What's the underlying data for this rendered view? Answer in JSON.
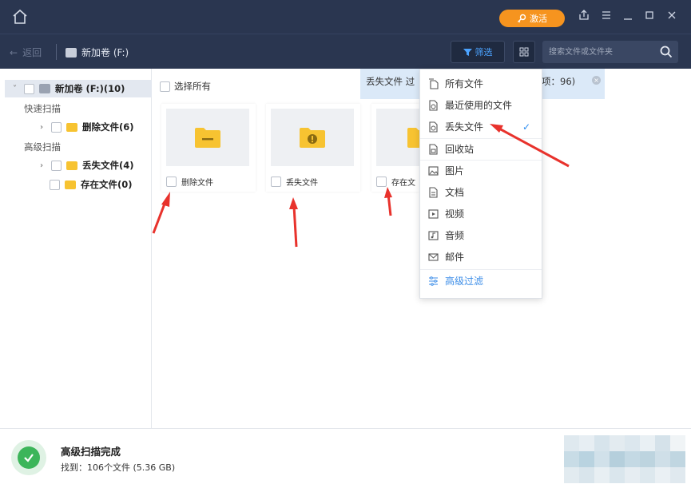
{
  "titlebar": {
    "activate_label": "激活",
    "icons": [
      "home-icon",
      "key-icon",
      "share-icon",
      "menu-icon",
      "minimize-icon",
      "maximize-icon",
      "close-icon"
    ]
  },
  "toolbar": {
    "back_label": "返回",
    "breadcrumb": "新加卷 (F:)",
    "filter_label": "筛选",
    "search_placeholder": "搜索文件或文件夹"
  },
  "sidebar": {
    "root_label": "新加卷 (F:)(10)",
    "quick_scan_label": "快速扫描",
    "deleted_files_label": "删除文件(6)",
    "advanced_scan_label": "高级扫描",
    "lost_files_label": "丢失文件(4)",
    "existing_files_label": "存在文件(0)"
  },
  "content": {
    "select_all_label": "选择所有",
    "info_text_left": "丢失文件 过",
    "info_text_right": "项：96)",
    "cards": [
      {
        "label": "删除文件"
      },
      {
        "label": "丢失文件"
      },
      {
        "label": "存在文"
      }
    ]
  },
  "dropdown": {
    "items": [
      {
        "label": "所有文件",
        "icon": "all-files-icon"
      },
      {
        "label": "最近使用的文件",
        "icon": "recent-files-icon"
      },
      {
        "label": "丢失文件",
        "icon": "lost-files-icon",
        "checked": true
      },
      {
        "label": "回收站",
        "icon": "recycle-bin-icon"
      },
      {
        "label": "图片",
        "icon": "image-icon"
      },
      {
        "label": "文档",
        "icon": "document-icon"
      },
      {
        "label": "视频",
        "icon": "video-icon"
      },
      {
        "label": "音频",
        "icon": "audio-icon"
      },
      {
        "label": "邮件",
        "icon": "mail-icon"
      },
      {
        "label": "高级过滤",
        "icon": "advanced-filter-icon"
      }
    ],
    "check_mark": "✓"
  },
  "status": {
    "title": "高级扫描完成",
    "found_text": "找到：106个文件 (5.36 GB)"
  },
  "colors": {
    "titlebar_bg": "#2a3650",
    "accent_orange": "#f6941f",
    "accent_blue": "#2b8cf0",
    "folder_yellow": "#f7c331",
    "success_green": "#3cb55a",
    "annotation_red": "#e8322c"
  }
}
